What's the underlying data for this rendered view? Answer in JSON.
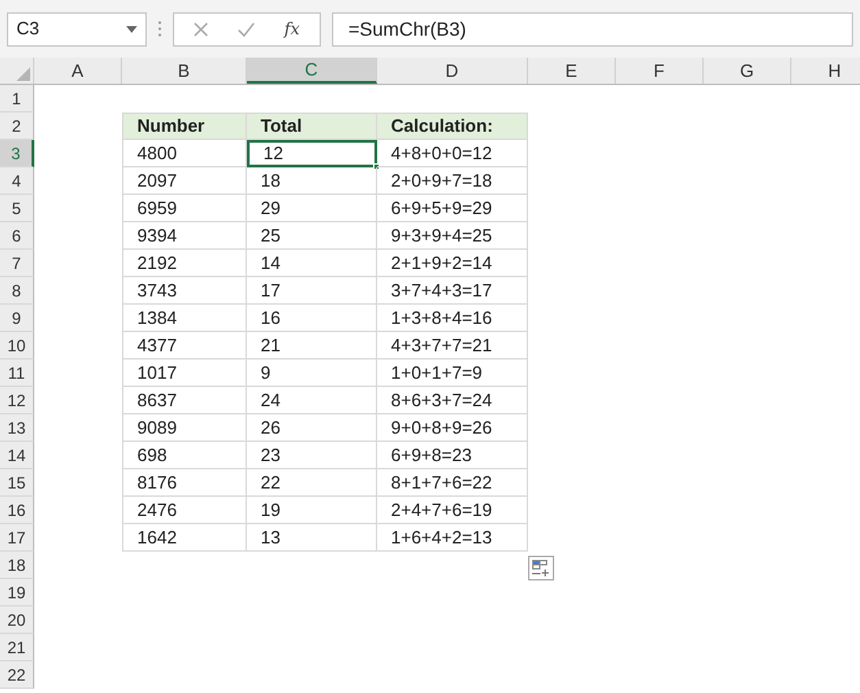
{
  "name_box": "C3",
  "formula_bar": {
    "function_label": "fx",
    "formula": "=SumChr(B3)"
  },
  "columns": [
    {
      "label": "A",
      "selected": false
    },
    {
      "label": "B",
      "selected": false
    },
    {
      "label": "C",
      "selected": true
    },
    {
      "label": "D",
      "selected": false
    },
    {
      "label": "E",
      "selected": false
    },
    {
      "label": "F",
      "selected": false
    },
    {
      "label": "G",
      "selected": false
    },
    {
      "label": "H",
      "selected": false
    }
  ],
  "rows": [
    {
      "label": "1",
      "selected": false
    },
    {
      "label": "2",
      "selected": false
    },
    {
      "label": "3",
      "selected": true
    },
    {
      "label": "4",
      "selected": false
    },
    {
      "label": "5",
      "selected": false
    },
    {
      "label": "6",
      "selected": false
    },
    {
      "label": "7",
      "selected": false
    },
    {
      "label": "8",
      "selected": false
    },
    {
      "label": "9",
      "selected": false
    },
    {
      "label": "10",
      "selected": false
    },
    {
      "label": "11",
      "selected": false
    },
    {
      "label": "12",
      "selected": false
    },
    {
      "label": "13",
      "selected": false
    },
    {
      "label": "14",
      "selected": false
    },
    {
      "label": "15",
      "selected": false
    },
    {
      "label": "16",
      "selected": false
    },
    {
      "label": "17",
      "selected": false
    },
    {
      "label": "18",
      "selected": false
    },
    {
      "label": "19",
      "selected": false
    },
    {
      "label": "20",
      "selected": false
    },
    {
      "label": "21",
      "selected": false
    },
    {
      "label": "22",
      "selected": false
    }
  ],
  "table": {
    "header": [
      "Number",
      "Total",
      "Calculation:"
    ],
    "rows": [
      [
        {
          "text": "4800",
          "selected": false
        },
        {
          "text": "12",
          "selected": true
        },
        {
          "text": "4+8+0+0=12",
          "selected": false
        }
      ],
      [
        {
          "text": "2097",
          "selected": false
        },
        {
          "text": "18",
          "selected": false
        },
        {
          "text": "2+0+9+7=18",
          "selected": false
        }
      ],
      [
        {
          "text": "6959",
          "selected": false
        },
        {
          "text": "29",
          "selected": false
        },
        {
          "text": "6+9+5+9=29",
          "selected": false
        }
      ],
      [
        {
          "text": "9394",
          "selected": false
        },
        {
          "text": "25",
          "selected": false
        },
        {
          "text": "9+3+9+4=25",
          "selected": false
        }
      ],
      [
        {
          "text": "2192",
          "selected": false
        },
        {
          "text": "14",
          "selected": false
        },
        {
          "text": "2+1+9+2=14",
          "selected": false
        }
      ],
      [
        {
          "text": "3743",
          "selected": false
        },
        {
          "text": "17",
          "selected": false
        },
        {
          "text": "3+7+4+3=17",
          "selected": false
        }
      ],
      [
        {
          "text": "1384",
          "selected": false
        },
        {
          "text": "16",
          "selected": false
        },
        {
          "text": "1+3+8+4=16",
          "selected": false
        }
      ],
      [
        {
          "text": "4377",
          "selected": false
        },
        {
          "text": "21",
          "selected": false
        },
        {
          "text": "4+3+7+7=21",
          "selected": false
        }
      ],
      [
        {
          "text": "1017",
          "selected": false
        },
        {
          "text": "9",
          "selected": false
        },
        {
          "text": "1+0+1+7=9",
          "selected": false
        }
      ],
      [
        {
          "text": "8637",
          "selected": false
        },
        {
          "text": "24",
          "selected": false
        },
        {
          "text": "8+6+3+7=24",
          "selected": false
        }
      ],
      [
        {
          "text": "9089",
          "selected": false
        },
        {
          "text": "26",
          "selected": false
        },
        {
          "text": "9+0+8+9=26",
          "selected": false
        }
      ],
      [
        {
          "text": "698",
          "selected": false
        },
        {
          "text": "23",
          "selected": false
        },
        {
          "text": "6+9+8=23",
          "selected": false
        }
      ],
      [
        {
          "text": "8176",
          "selected": false
        },
        {
          "text": "22",
          "selected": false
        },
        {
          "text": "8+1+7+6=22",
          "selected": false
        }
      ],
      [
        {
          "text": "2476",
          "selected": false
        },
        {
          "text": "19",
          "selected": false
        },
        {
          "text": "2+4+7+6=19",
          "selected": false
        }
      ],
      [
        {
          "text": "1642",
          "selected": false
        },
        {
          "text": "13",
          "selected": false
        },
        {
          "text": "1+6+4+2=13",
          "selected": false
        }
      ]
    ]
  }
}
